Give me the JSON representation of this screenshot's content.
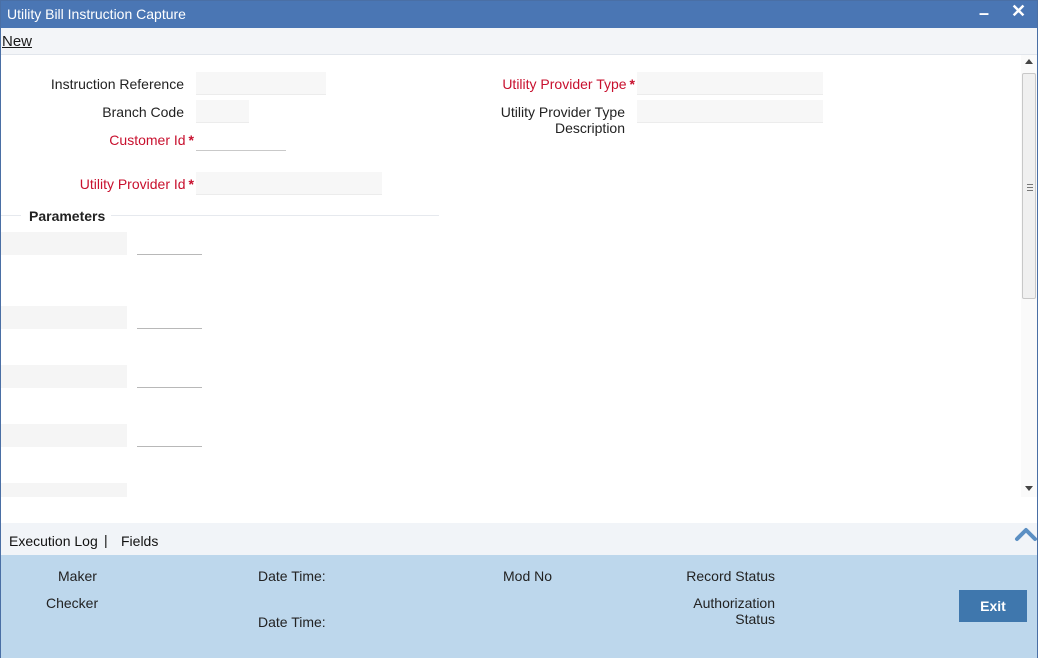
{
  "window": {
    "title": "Utility Bill Instruction Capture",
    "minimize_label": "–",
    "close_label": "✕"
  },
  "menu": {
    "new_label": "New"
  },
  "form": {
    "instruction_reference_label": "Instruction Reference",
    "branch_code_label": "Branch Code",
    "customer_id_label": "Customer Id",
    "utility_provider_id_label": "Utility Provider Id",
    "utility_provider_type_label": "Utility Provider Type",
    "utility_provider_type_desc_label_line1": "Utility Provider Type",
    "utility_provider_type_desc_label_line2": "Description",
    "required_marker": "*",
    "parameters_section_label": "Parameters"
  },
  "footer_tabs": {
    "execution_log_label": "Execution Log",
    "separator": "|",
    "fields_label": "Fields"
  },
  "audit": {
    "maker_label": "Maker",
    "checker_label": "Checker",
    "date_time_label": "Date Time:",
    "mod_no_label": "Mod No",
    "record_status_label": "Record Status",
    "authorization_status_line1": "Authorization",
    "authorization_status_line2": "Status",
    "exit_label": "Exit"
  },
  "colors": {
    "title_bar": "#4a76b4",
    "required_text": "#c8102e",
    "audit_panel": "#bdd7ec",
    "exit_button": "#3f77ad"
  }
}
